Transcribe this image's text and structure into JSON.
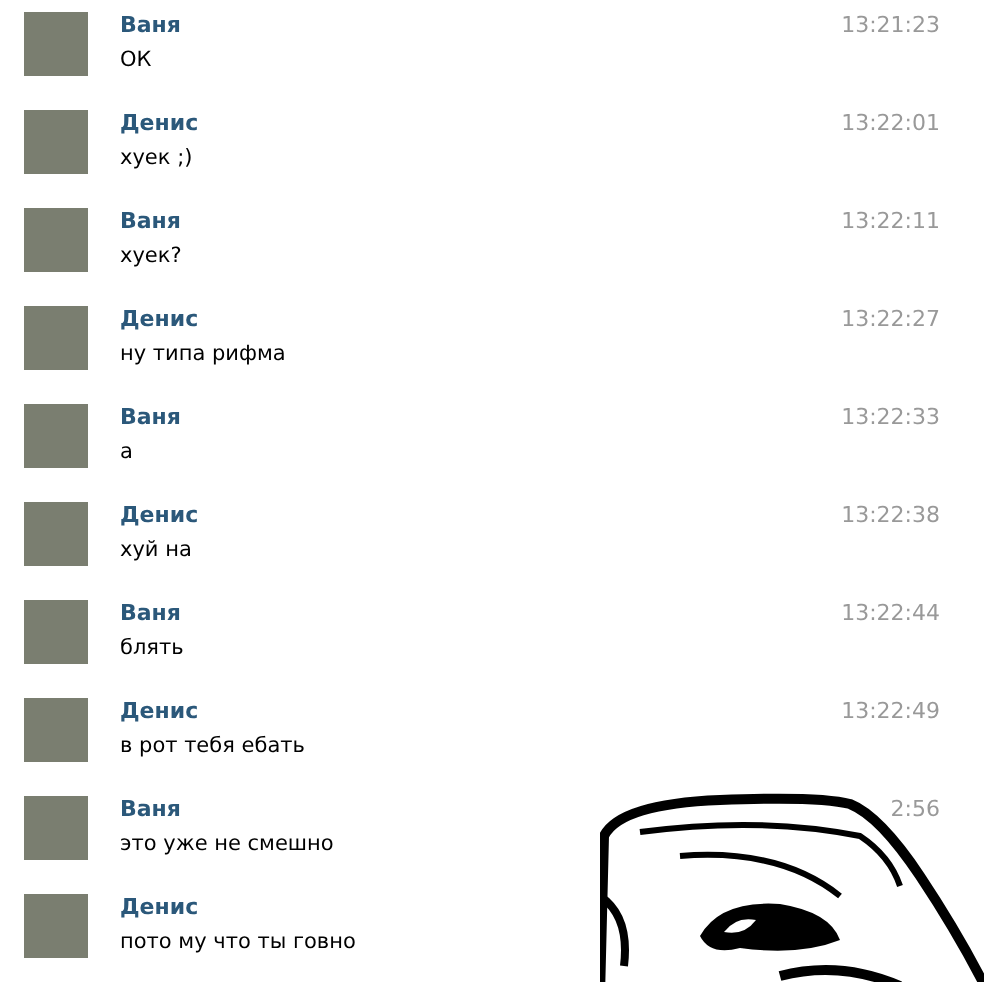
{
  "messages": [
    {
      "author": "Ваня",
      "time": "13:21:23",
      "text": "ОК"
    },
    {
      "author": "Денис",
      "time": "13:22:01",
      "text": "хуек ;)"
    },
    {
      "author": "Ваня",
      "time": "13:22:11",
      "text": "хуек?"
    },
    {
      "author": "Денис",
      "time": "13:22:27",
      "text": "ну типа рифма"
    },
    {
      "author": "Ваня",
      "time": "13:22:33",
      "text": "а"
    },
    {
      "author": "Денис",
      "time": "13:22:38",
      "text": "хуй на"
    },
    {
      "author": "Ваня",
      "time": "13:22:44",
      "text": "блять"
    },
    {
      "author": "Денис",
      "time": "13:22:49",
      "text": "в рот тебя ебать"
    },
    {
      "author": "Ваня",
      "time": "2:56",
      "text": "это уже не смешно"
    },
    {
      "author": "Денис",
      "text": "пото му что ты говно"
    }
  ]
}
